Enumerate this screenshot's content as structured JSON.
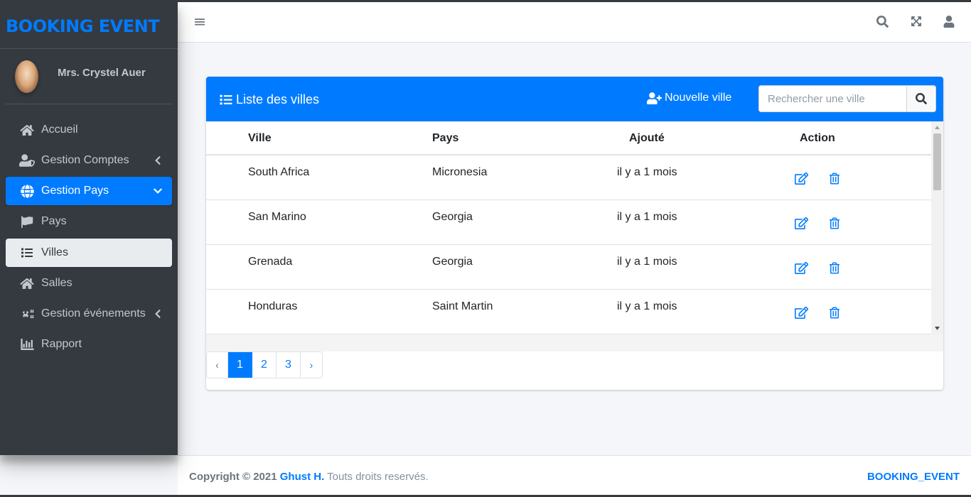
{
  "brand": "BOOKING EVENT",
  "user": {
    "name": "Mrs. Crystel Auer"
  },
  "sidebar": {
    "items": [
      {
        "label": "Accueil",
        "icon": "home-icon"
      },
      {
        "label": "Gestion Comptes",
        "icon": "user-shield-icon"
      },
      {
        "label": "Gestion Pays",
        "icon": "globe-icon"
      },
      {
        "label": "Pays",
        "icon": "flag-icon"
      },
      {
        "label": "Villes",
        "icon": "list-icon"
      },
      {
        "label": "Salles",
        "icon": "home-icon"
      },
      {
        "label": "Gestion événements",
        "icon": "cogs-icon"
      },
      {
        "label": "Rapport",
        "icon": "chart-bar-icon"
      }
    ]
  },
  "card": {
    "title": "Liste des villes",
    "new_button": "Nouvelle ville",
    "search_placeholder": "Rechercher une ville"
  },
  "table": {
    "headers": [
      "Ville",
      "Pays",
      "Ajouté",
      "Action"
    ],
    "rows": [
      {
        "ville": "South Africa",
        "pays": "Micronesia",
        "ajoute": "il y a 1 mois"
      },
      {
        "ville": "San Marino",
        "pays": "Georgia",
        "ajoute": "il y a 1 mois"
      },
      {
        "ville": "Grenada",
        "pays": "Georgia",
        "ajoute": "il y a 1 mois"
      },
      {
        "ville": "Honduras",
        "pays": "Saint Martin",
        "ajoute": "il y a 1 mois"
      }
    ]
  },
  "pagination": {
    "prev": "‹",
    "pages": [
      "1",
      "2",
      "3"
    ],
    "next": "›",
    "current": "1"
  },
  "footer": {
    "copyright": "Copyright © 2021",
    "author": "Ghust H.",
    "rights": "Touts droits reservés.",
    "brand_right": "BOOKING_EVENT"
  },
  "colors": {
    "accent": "#007bff",
    "sidebar_bg": "#343a40",
    "page_bg": "#f4f6f9"
  }
}
